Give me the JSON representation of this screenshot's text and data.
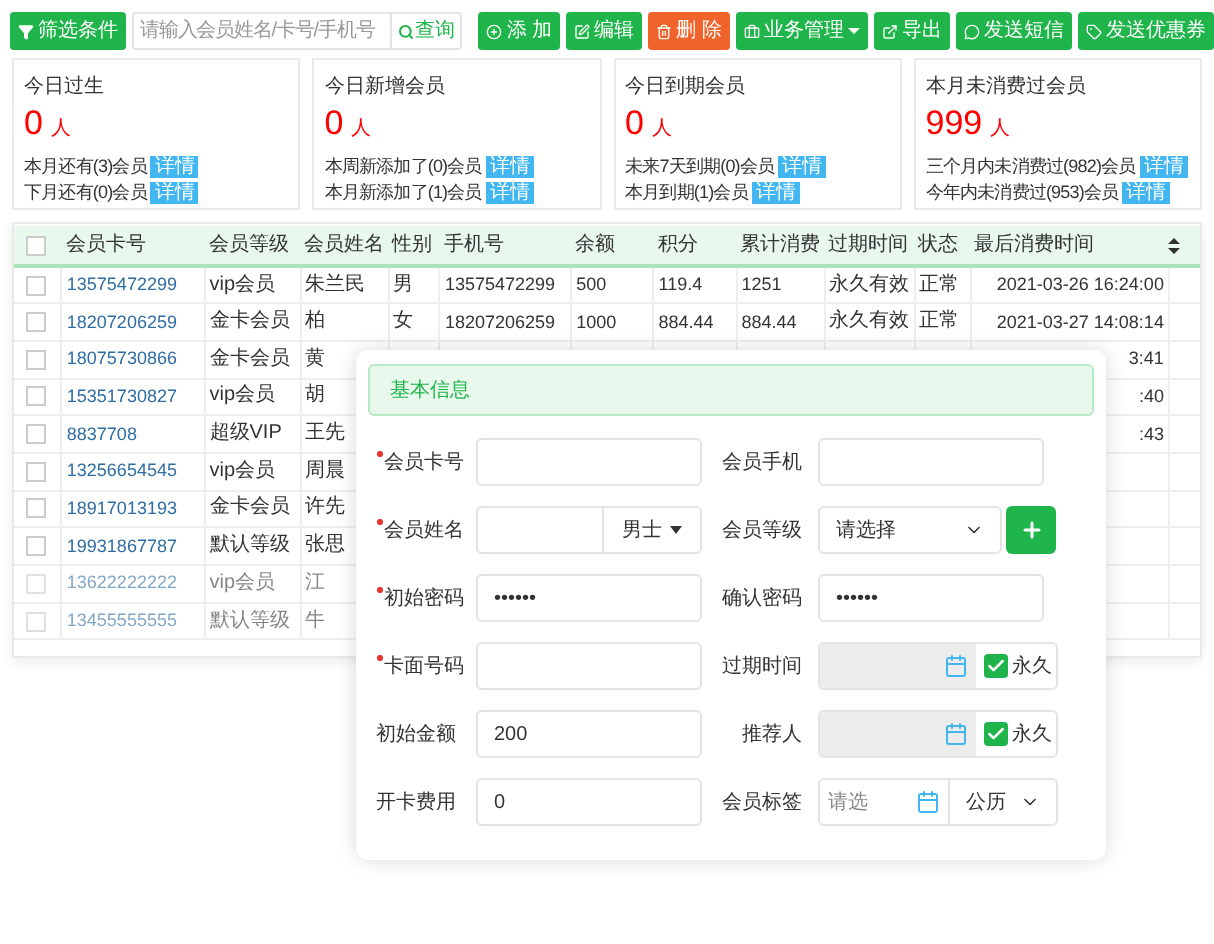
{
  "toolbar": {
    "filter_button": "筛选条件",
    "search": {
      "placeholder": "请输入会员姓名/卡号/手机号",
      "button": "查询"
    },
    "actions": [
      {
        "kind": "add",
        "label": "添 加",
        "color": "#1fb54a"
      },
      {
        "kind": "edit",
        "label": "编辑",
        "color": "#1fb54a"
      },
      {
        "kind": "delete",
        "label": "删 除",
        "color": "#f0642b"
      },
      {
        "kind": "menu",
        "label": "业务管理",
        "color": "#1fb54a"
      },
      {
        "kind": "export",
        "label": "导出",
        "color": "#1fb54a"
      },
      {
        "kind": "sms",
        "label": "发送短信",
        "color": "#1fb54a"
      },
      {
        "kind": "coupon",
        "label": "发送优惠券",
        "color": "#1fb54a"
      }
    ]
  },
  "stats": [
    {
      "title": "今日过生",
      "count": "0",
      "unit": "人",
      "lines": [
        {
          "text": "本月还有(3)会员",
          "link": "详情"
        },
        {
          "text": "下月还有(0)会员",
          "link": "详情"
        }
      ]
    },
    {
      "title": "今日新增会员",
      "count": "0",
      "unit": "人",
      "lines": [
        {
          "text": "本周新添加了(0)会员",
          "link": "详情"
        },
        {
          "text": "本月新添加了(1)会员",
          "link": "详情"
        }
      ]
    },
    {
      "title": "今日到期会员",
      "count": "0",
      "unit": "人",
      "lines": [
        {
          "text": "未来7天到期(0)会员",
          "link": "详情"
        },
        {
          "text": "本月到期(1)会员",
          "link": "详情"
        }
      ]
    },
    {
      "title": "本月未消费过会员",
      "count": "999",
      "unit": "人",
      "lines": [
        {
          "text": "三个月内未消费过(982)会员",
          "link": "详情"
        },
        {
          "text": "今年内未消费过(953)会员",
          "link": "详情"
        }
      ]
    }
  ],
  "table": {
    "select_all_checked": false,
    "columns": [
      "会员卡号",
      "会员等级",
      "会员姓名",
      "性别",
      "手机号",
      "余额",
      "积分",
      "累计消费",
      "过期时间",
      "状态",
      "最后消费时间"
    ],
    "rows": [
      {
        "checked": false,
        "cells": [
          "13575472299",
          "vip会员",
          "朱兰民",
          "男",
          "13575472299",
          "500",
          "119.4",
          "1251",
          "永久有效",
          "正常",
          "2021-03-26 16:24:00"
        ]
      },
      {
        "checked": false,
        "cells": [
          "18207206259",
          "金卡会员",
          "柏",
          "女",
          "18207206259",
          "1000",
          "884.44",
          "884.44",
          "永久有效",
          "正常",
          "2021-03-27 14:08:14"
        ]
      },
      {
        "checked": false,
        "cells": [
          "18075730866",
          "金卡会员",
          "黄",
          null,
          null,
          null,
          null,
          null,
          null,
          null,
          "3:41"
        ]
      },
      {
        "checked": false,
        "cells": [
          "15351730827",
          "vip会员",
          "胡",
          null,
          null,
          null,
          null,
          null,
          null,
          null,
          ":40"
        ]
      },
      {
        "checked": false,
        "cells": [
          "8837708",
          "超级VIP",
          "王先",
          null,
          null,
          null,
          null,
          null,
          null,
          null,
          ":43"
        ]
      },
      {
        "checked": false,
        "cells": [
          "13256654545",
          "vip会员",
          "周晨"
        ]
      },
      {
        "checked": false,
        "cells": [
          "18917013193",
          "金卡会员",
          "许先"
        ]
      },
      {
        "checked": false,
        "cells": [
          "19931867787",
          "默认等级",
          "张思"
        ]
      },
      {
        "checked": false,
        "cells": [
          "13622222222",
          "vip会员",
          "江"
        ]
      },
      {
        "checked": false,
        "cells": [
          "13455555555",
          "默认等级",
          "牛"
        ]
      }
    ]
  },
  "form": {
    "title": "基本信息",
    "rows": [
      [
        {
          "label": "会员卡号",
          "required": true,
          "kind": "text"
        },
        {
          "label": "会员手机",
          "required": false,
          "kind": "text"
        }
      ],
      [
        {
          "label": "会员姓名",
          "required": true,
          "kind": "text_select",
          "select": "男士"
        },
        {
          "label": "会员等级",
          "required": false,
          "kind": "select_add",
          "value": "请选择"
        }
      ],
      [
        {
          "label": "初始密码",
          "required": true,
          "kind": "text",
          "value": "••••••"
        },
        {
          "label": "确认密码",
          "required": false,
          "kind": "text",
          "value": "••••••"
        }
      ],
      [
        {
          "label": "卡面号码",
          "required": true,
          "kind": "text"
        },
        {
          "label": "过期时间",
          "required": false,
          "kind": "date_check",
          "checked": true,
          "check_label": "永久"
        }
      ],
      [
        {
          "label": "初始金额",
          "required": false,
          "kind": "text",
          "value": "200"
        },
        {
          "label": "推荐人",
          "required": false,
          "kind": "date_check",
          "checked": true,
          "check_label": "永久"
        }
      ],
      [
        {
          "label": "开卡费用",
          "required": false,
          "kind": "text",
          "value": "0"
        },
        {
          "label": "会员标签",
          "required": false,
          "kind": "date_select",
          "placeholder": "请选",
          "select": "公历"
        }
      ]
    ]
  }
}
